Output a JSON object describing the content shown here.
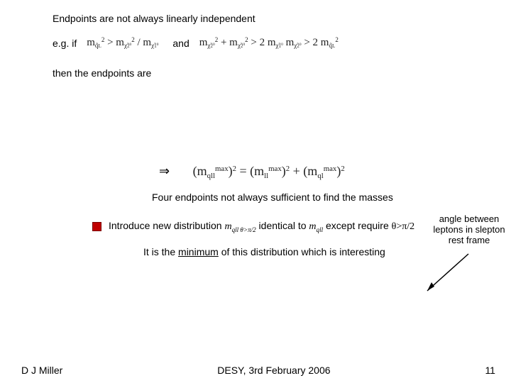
{
  "slide": {
    "line1": "Endpoints are not always linearly independent",
    "eg_if": "e.g. if",
    "and": "and",
    "then": "then the endpoints are",
    "summary": "Four endpoints not always sufficient to find the masses",
    "annot": {
      "l1": "angle between",
      "l2": "leptons in slepton",
      "l3": "rest frame"
    },
    "bullet": {
      "a": "Introduce new distribution ",
      "b": " identical to ",
      "c": " except require "
    },
    "minline_a": "It is the ",
    "minline_u": "minimum",
    "minline_b": " of this distribution which is interesting"
  },
  "math": {
    "cond1_html": "m<span class='subn'>q̃<span style=\"font-size:0.8em\">L</span></span><span class='supn'>2</span> &gt; m<span class='subn'>χ̃<span style=\"font-size:0.8em\">2</span><span class=\"supn\">0</span></span><span class='supn'>2</span> / m<span class='subn'>χ̃<span style=\"font-size:0.8em\">1</span><span class=\"supn\">0</span></span>",
    "cond2_html": "m<span class='subn'>χ̃<span style=\"font-size:0.8em\">2</span><span class=\"supn\">0</span></span><span class='supn'>2</span> + m<span class='subn'>χ̃<span style=\"font-size:0.8em\">2</span><span class=\"supn\">0</span></span><span class='supn'>2</span> &gt; 2 m<span class='subn'>χ̃<span style=\"font-size:0.8em\">1</span><span class=\"supn\">0</span></span> m<span class='subn'>χ̃<span style=\"font-size:0.8em\">2</span><span class=\"supn\">0</span></span> &gt; 2 m<span class='subn'>q̃<span style=\"font-size:0.8em\">L</span></span><span class='supn'>2</span>",
    "arrow": "⇒",
    "relation_html": "(m<span class='subn'>qll</span><span class='supn'>max</span>)<span class='supn'>2</span> = (m<span class='subn'>ll</span><span class='supn'>max</span>)<span class='supn'>2</span> + (m<span class='subn'>ql</span><span class='supn'>max</span>)<span class='supn'>2</span>",
    "dist1": "m",
    "dist1_sub": "qll θ>π/2",
    "dist2": "m",
    "dist2_sub": "qll",
    "req": "θ>π/2"
  },
  "footer": {
    "author": "D J Miller",
    "venue": "DESY, 3rd February 2006",
    "page": "11"
  }
}
